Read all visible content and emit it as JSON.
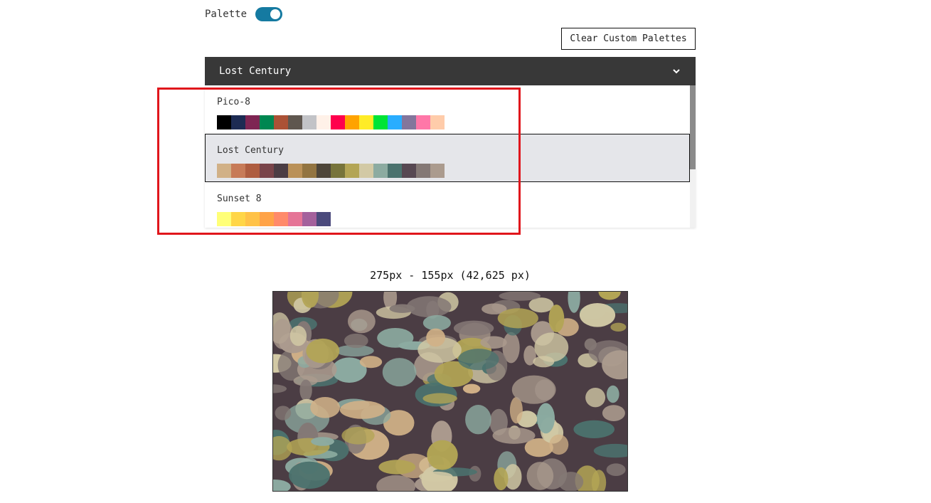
{
  "toggle": {
    "label": "Palette",
    "on": true,
    "color": "#157aa1"
  },
  "clear_button": {
    "label": "Clear Custom Palettes"
  },
  "dropdown": {
    "selected": "Lost Century",
    "header_color": "#383838",
    "chevron_icon": "chevron-down-icon"
  },
  "palettes": [
    {
      "name": "Pico-8",
      "colors": [
        "#000000",
        "#1d2b53",
        "#7e2553",
        "#008751",
        "#ab5236",
        "#5f574f",
        "#c2c3c7",
        "#fff1e8",
        "#ff004d",
        "#ffa300",
        "#ffec27",
        "#00e436",
        "#29adff",
        "#83769c",
        "#ff77a8",
        "#ffccaa"
      ]
    },
    {
      "name": "Lost Century",
      "colors": [
        "#d1b187",
        "#c77b58",
        "#ae5d40",
        "#79444a",
        "#4b3d44",
        "#ba9158",
        "#927441",
        "#4d4539",
        "#77743b",
        "#b3a555",
        "#d2c9a5",
        "#8caba1",
        "#4b726e",
        "#574852",
        "#847875",
        "#ab9b8e"
      ]
    },
    {
      "name": "Sunset 8",
      "colors": [
        "#ffff78",
        "#ffd647",
        "#ffc247",
        "#ffa347",
        "#ff8a6a",
        "#e57496",
        "#a4619c",
        "#4b4a7c"
      ]
    }
  ],
  "highlight_color": "#e0161c",
  "image": {
    "dimensions_text": "275px - 155px (42,625 px)",
    "background_color": "#4b3d44"
  }
}
